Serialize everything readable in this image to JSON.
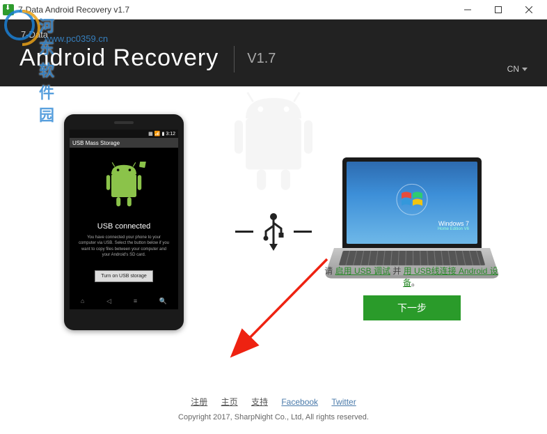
{
  "titlebar": {
    "title": "7-Data Android Recovery v1.7"
  },
  "watermark": {
    "text": "河东软件园",
    "url": "www.pc0359.cn"
  },
  "header": {
    "brand_small": "7-Data",
    "brand_large": "Android Recovery",
    "version": "V1.7",
    "lang": "CN"
  },
  "phone": {
    "statusbar_time": "3:12",
    "topbar": "USB Mass Storage",
    "usb_title": "USB connected",
    "usb_desc": "You have connected your phone to your computer via USB. Select the button below if you want to copy files between your computer and your Android's SD card.",
    "usb_button": "Turn on USB storage"
  },
  "laptop": {
    "os_label": "Windows 7",
    "os_sub": "Home Edition V6"
  },
  "instruction": {
    "prefix": "请 ",
    "link1": "启用 USB 调试",
    "mid": " 并 ",
    "link2": "用 USB线连接 Android 设备",
    "suffix": "。"
  },
  "next_button": "下一步",
  "footer": {
    "links": {
      "register": "注册",
      "home": "主页",
      "support": "支持",
      "facebook": "Facebook",
      "twitter": "Twitter"
    },
    "copyright": "Copyright 2017, SharpNight Co., Ltd, All rights reserved."
  }
}
